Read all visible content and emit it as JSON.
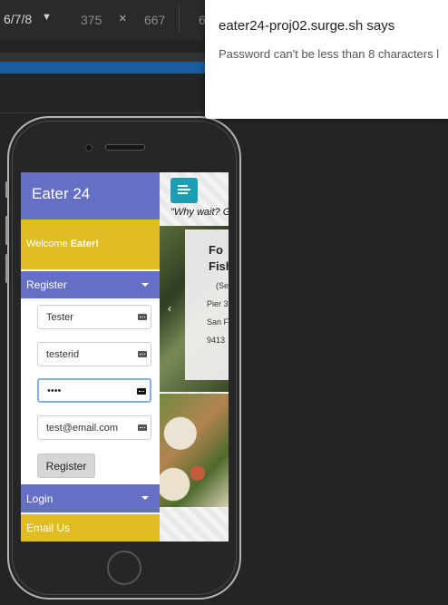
{
  "devtools": {
    "device": "6/7/8",
    "width": "375",
    "times": "×",
    "height": "667",
    "more": "6"
  },
  "alert": {
    "title": "eater24-proj02.surge.sh says",
    "message": "Password can't be less than 8 characters l"
  },
  "app": {
    "title": "Eater 24",
    "welcome_prefix": "Welcome ",
    "welcome_name": "Eater!",
    "register_label": "Register",
    "fields": {
      "name": "Tester",
      "userid": "testerid",
      "password": "••••",
      "email": "test@email.com"
    },
    "register_button": "Register",
    "login_label": "Login",
    "email_us_label": "Email Us"
  },
  "main": {
    "tagline": "\"Why wait? G",
    "card_title_1": "Fo",
    "card_title_2": "Fish",
    "card_line_1": "(Se",
    "card_line_2": "Pier 3",
    "card_line_3": "San F",
    "card_line_4": "9413",
    "prev_glyph": "‹"
  },
  "colors": {
    "primary": "#6570c4",
    "accent": "#dfbc22",
    "menu_button": "#1d9fb3"
  }
}
